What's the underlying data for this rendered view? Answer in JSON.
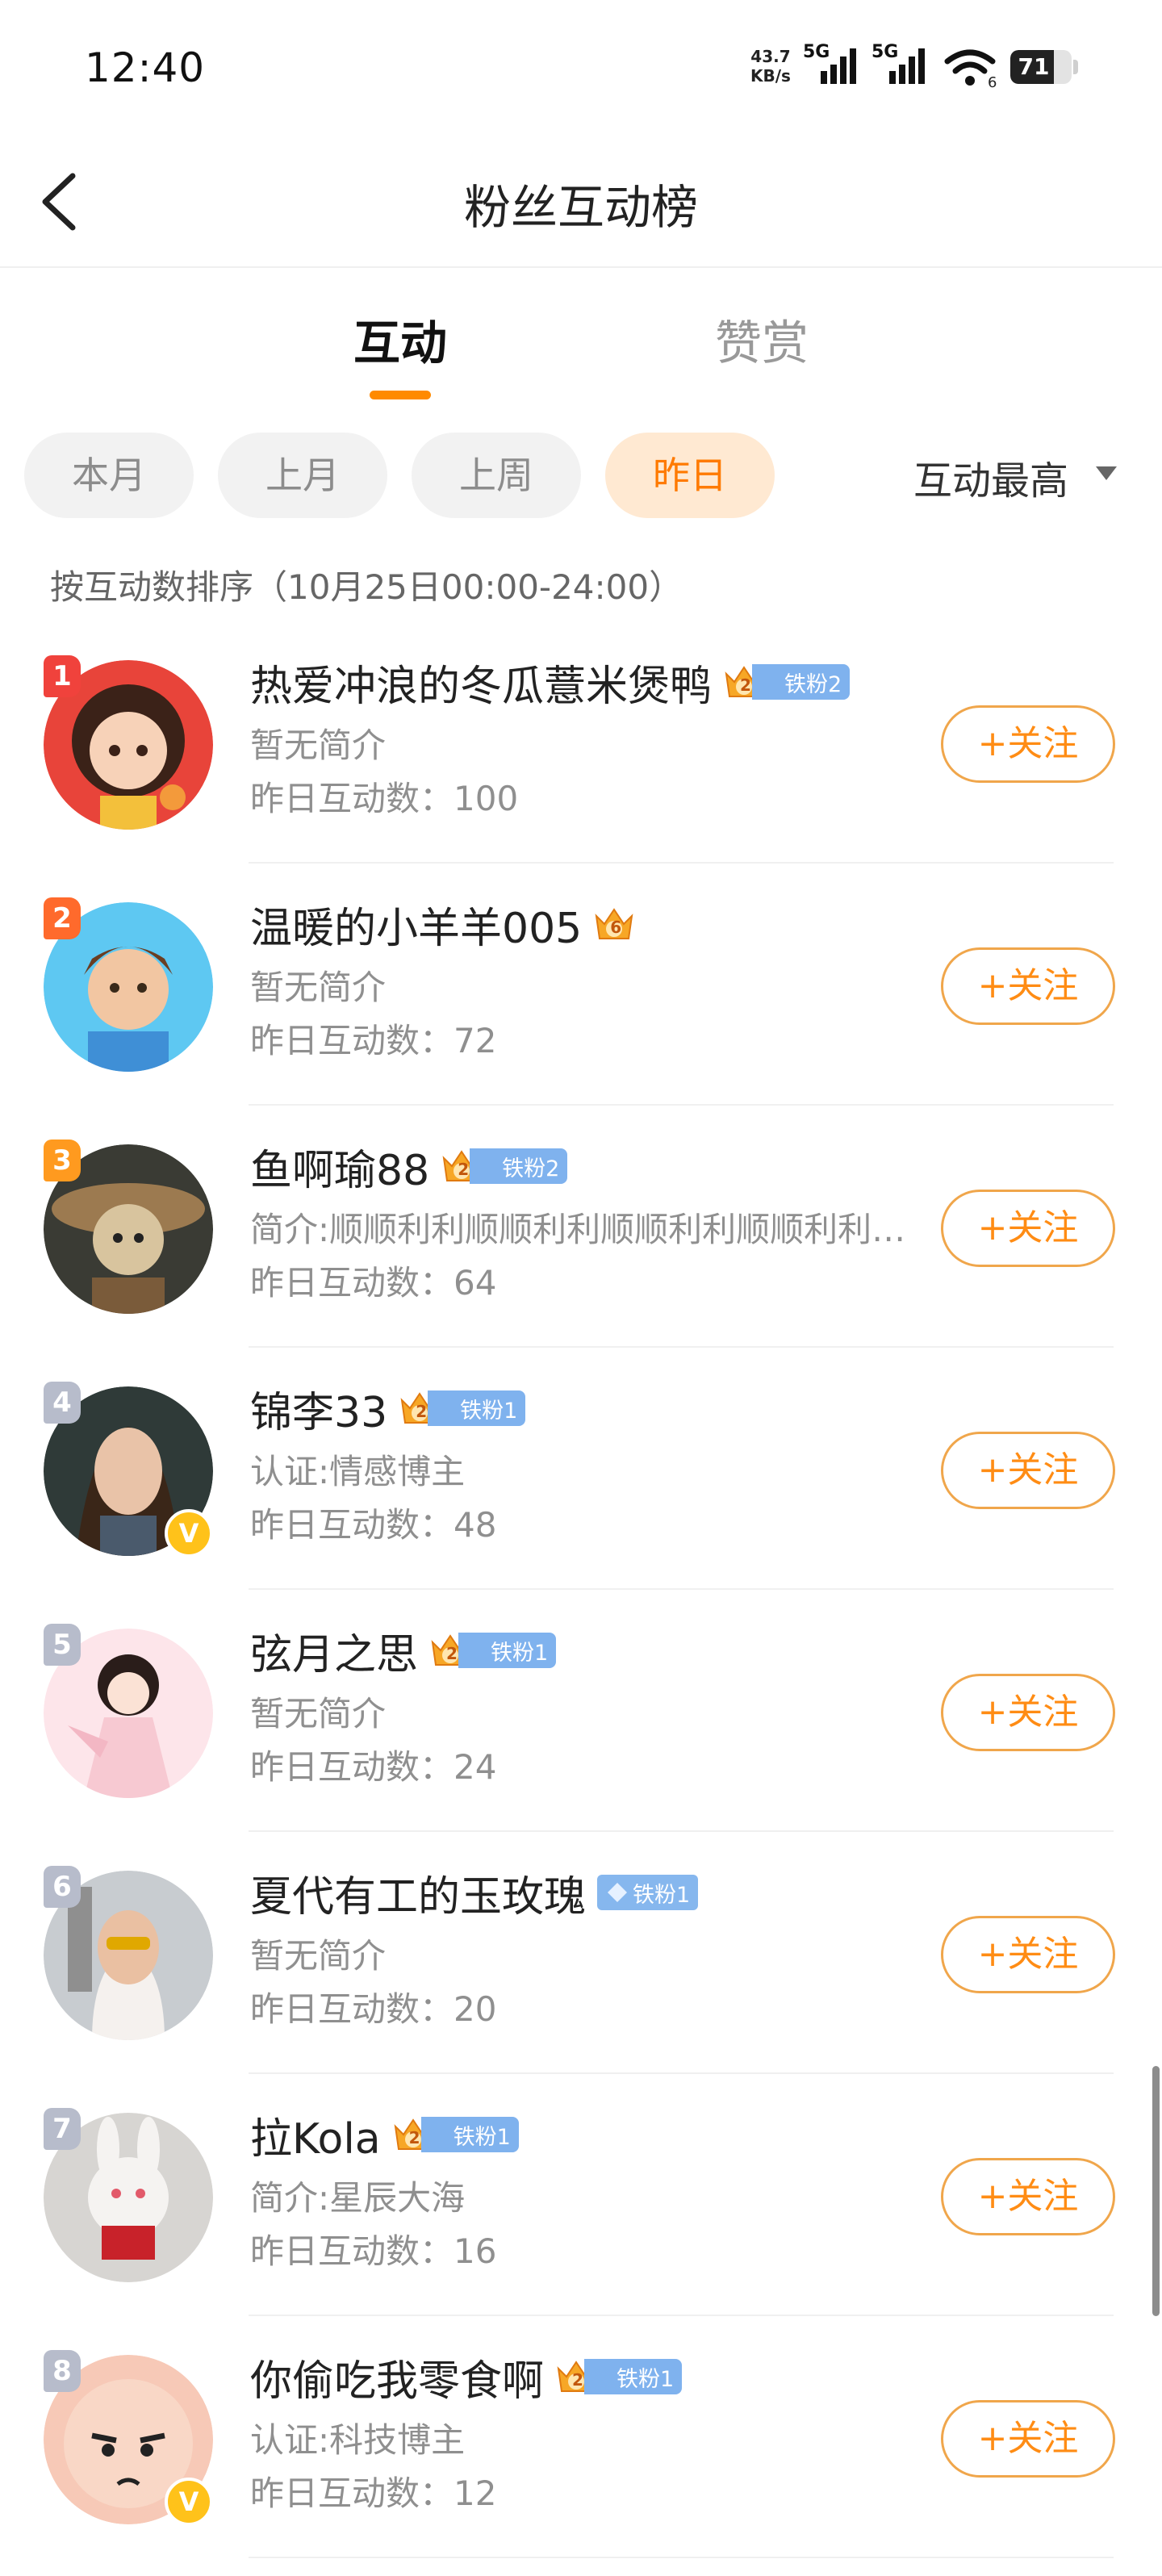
{
  "status_bar": {
    "time": "12:40",
    "net_speed_value": "43.7",
    "net_speed_unit": "KB/s",
    "signal1_label": "5G",
    "signal2_label": "5G",
    "wifi_label": "6",
    "battery": "71",
    "battery_level": 0.71
  },
  "header": {
    "title": "粉丝互动榜",
    "back_icon": "chevron-left-icon"
  },
  "tabs": [
    {
      "label": "互动",
      "active": true
    },
    {
      "label": "赞赏",
      "active": false
    }
  ],
  "filters": [
    {
      "label": "本月",
      "active": false
    },
    {
      "label": "上月",
      "active": false
    },
    {
      "label": "上周",
      "active": false
    },
    {
      "label": "昨日",
      "active": true
    }
  ],
  "sort": {
    "label": "互动最高",
    "icon": "caret-down-icon"
  },
  "sort_description": "按互动数排序（10月25日00:00-24:00）",
  "follow_label": "+关注",
  "fans": [
    {
      "rank": "1",
      "name": "热爱冲浪的冬瓜薏米煲鸭",
      "crown_level": "2",
      "badge": "铁粉2",
      "subtitle": "暂无简介",
      "count": "昨日互动数：100",
      "verified": false
    },
    {
      "rank": "2",
      "name": "温暖的小羊羊005",
      "crown_level": "6",
      "badge": "",
      "subtitle": "暂无简介",
      "count": "昨日互动数：72",
      "verified": false
    },
    {
      "rank": "3",
      "name": "鱼啊瑜88",
      "crown_level": "2",
      "badge": "铁粉2",
      "subtitle": "简介:顺顺利利顺顺利利顺顺利利顺顺利利…",
      "count": "昨日互动数：64",
      "verified": false
    },
    {
      "rank": "4",
      "name": "锦李33",
      "crown_level": "2",
      "badge": "铁粉1",
      "subtitle": "认证:情感博主",
      "count": "昨日互动数：48",
      "verified": true
    },
    {
      "rank": "5",
      "name": "弦月之思",
      "crown_level": "2",
      "badge": "铁粉1",
      "subtitle": "暂无简介",
      "count": "昨日互动数：24",
      "verified": false
    },
    {
      "rank": "6",
      "name": "夏代有工的玉玫瑰",
      "crown_level": "",
      "badge": "铁粉1",
      "subtitle": "暂无简介",
      "count": "昨日互动数：20",
      "verified": false
    },
    {
      "rank": "7",
      "name": "拉Kola",
      "crown_level": "2",
      "badge": "铁粉1",
      "subtitle": "简介:星辰大海",
      "count": "昨日互动数：16",
      "verified": false
    },
    {
      "rank": "8",
      "name": "你偷吃我零食啊",
      "crown_level": "2",
      "badge": "铁粉1",
      "subtitle": "认证:科技博主",
      "count": "昨日互动数：12",
      "verified": true
    }
  ],
  "colors": {
    "accent": "#ff8a00",
    "rank1": "#f0423c",
    "rank2": "#ff6a2c",
    "rank3": "#ff9a1f",
    "rank_other": "#b7bccb",
    "fan_badge": "#7fb2ee"
  }
}
